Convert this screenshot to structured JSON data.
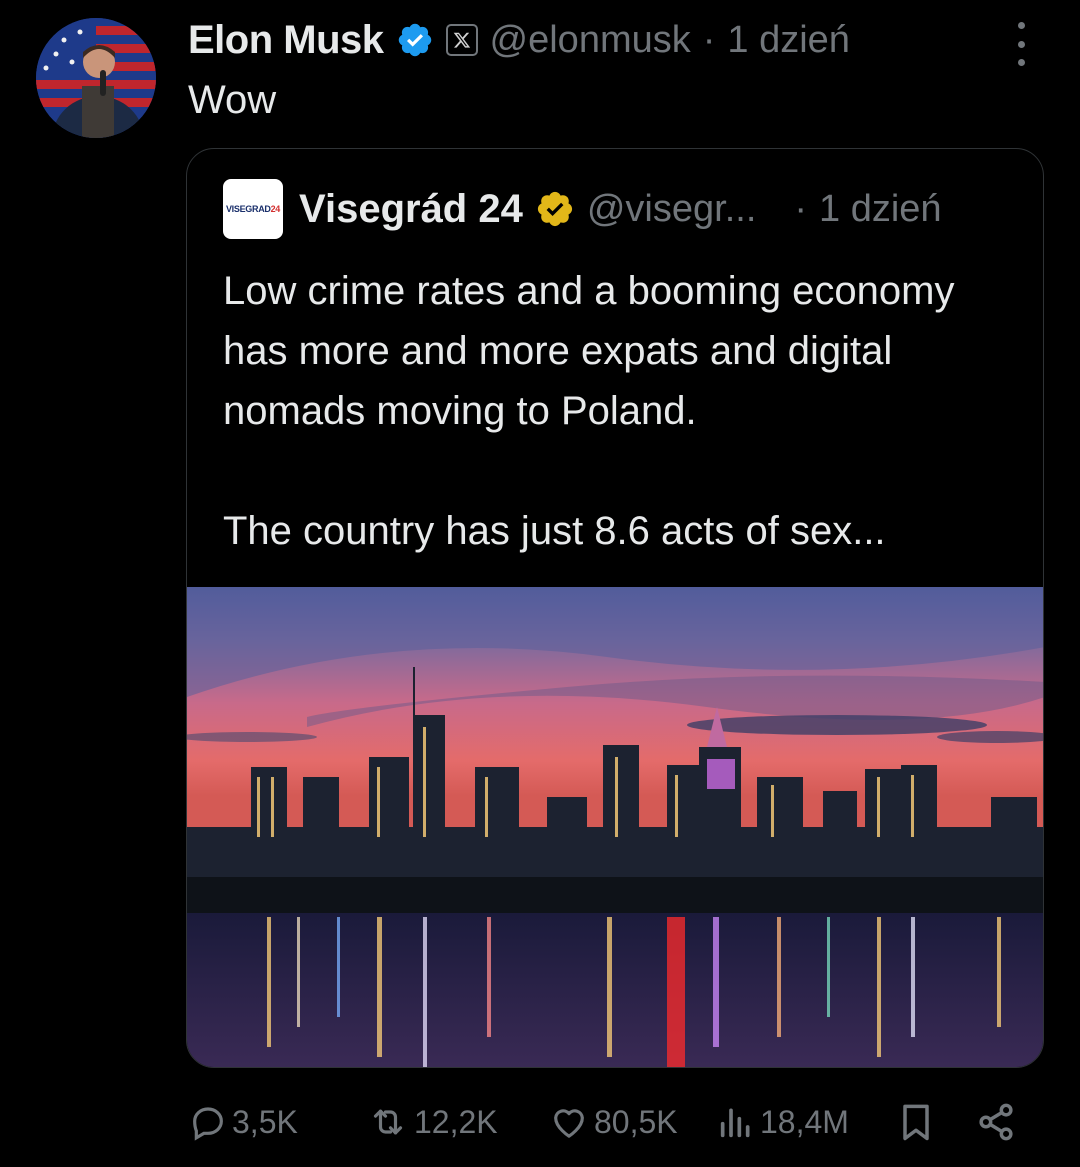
{
  "tweet": {
    "author_name": "Elon Musk",
    "handle": "@elonmusk",
    "separator": "·",
    "time": "1 dzień",
    "text": "Wow",
    "verified_color": "#1d9bf0"
  },
  "quote": {
    "author_name": "Visegrád 24",
    "logo_text_main": "VISEGRAD",
    "logo_text_accent": "24",
    "handle": "@visegr...",
    "separator": "·",
    "time": "1 dzień",
    "paragraph_1": "Low crime rates and a booming economy has more and more expats and digital nomads moving to Poland.",
    "paragraph_2": "The country has just 8.6 acts of sex...",
    "verified_color": "#e2b719"
  },
  "actions": {
    "replies": "3,5K",
    "reposts": "12,2K",
    "likes": "80,5K",
    "views": "18,4M"
  },
  "icons": {
    "reply": "reply-icon",
    "repost": "repost-icon",
    "like": "heart-icon",
    "views": "views-icon",
    "bookmark": "bookmark-icon",
    "share": "share-icon",
    "more": "more-options-icon"
  }
}
